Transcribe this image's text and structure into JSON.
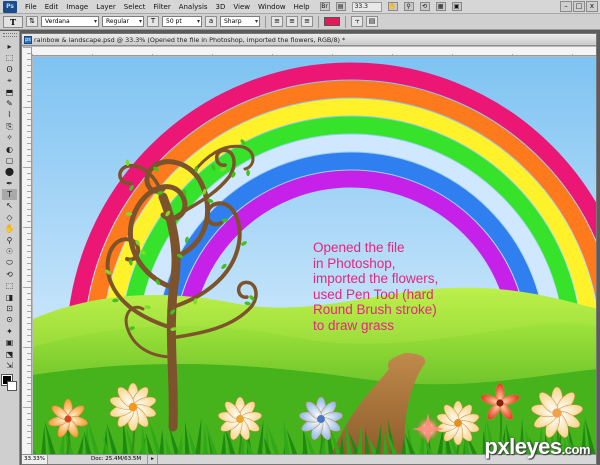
{
  "app": {
    "logo_text": "Ps",
    "menu": [
      "File",
      "Edit",
      "Image",
      "Layer",
      "Select",
      "Filter",
      "Analysis",
      "3D",
      "View",
      "Window",
      "Help"
    ],
    "zoom_value": "33.3",
    "window_controls": [
      "–",
      "□",
      "x"
    ]
  },
  "options": {
    "tool_glyph": "T",
    "font_family": "Verdana",
    "font_style": "Regular",
    "font_size": "50 pt",
    "anti_alias": "Sharp",
    "text_color": "#e41a5a"
  },
  "tools": {
    "glyphs": [
      "▸",
      "⬚",
      "ʘ",
      "⌖",
      "⬒",
      "✎",
      "⌇",
      "⎘",
      "✧",
      "◐",
      "▢",
      "⬤",
      "✒",
      "T",
      "↖",
      "◇",
      "✋",
      "⚲",
      "☉",
      "⬭",
      "⟲",
      "⬚",
      "◨",
      "⊡",
      "⊙",
      "✦",
      "▣",
      "⬔",
      "⇲"
    ]
  },
  "document": {
    "title": "rainbow & landscape.psd @ 33.3% (Opened the file     in Photoshop,     imported the flowers, RGB/8) *",
    "status_zoom": "33.33%",
    "status_info": "Doc: 25.4M/63.5M",
    "colors": {
      "sky_top": "#7ec3f2",
      "sky_bottom": "#eaf5ff",
      "rainbow": [
        "#ec1675",
        "#ff7a1c",
        "#fff12a",
        "#36e32a",
        "#cfe7ff",
        "#2f7ff0",
        "#c521e8"
      ],
      "grass_dark": "#2f9a16",
      "grass_light": "#9be23a",
      "trunk": "#7c532a",
      "path": "#a8733d"
    }
  },
  "caption": {
    "lines": [
      "Opened the file",
      "in Photoshop,",
      "imported the flowers,",
      "used Pen Tool (hard",
      "Round Brush stroke)",
      "to draw grass"
    ]
  },
  "watermark": {
    "brand": "pxleyes",
    "tld": ".com"
  }
}
